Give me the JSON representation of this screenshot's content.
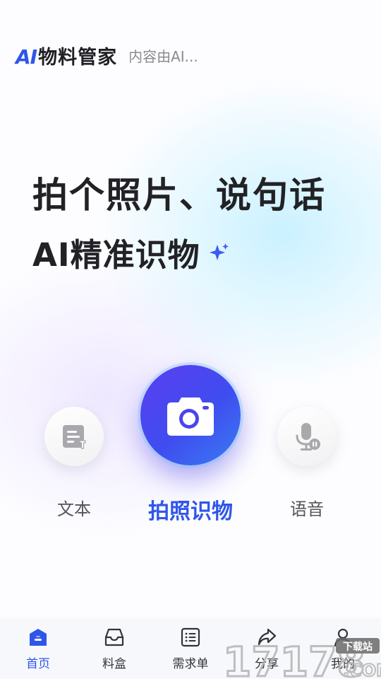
{
  "header": {
    "logo_ai": "AI",
    "logo_cn": "物料管家",
    "tagline": "内容由AI..."
  },
  "hero": {
    "line1": "拍个照片、说句话",
    "line2": "AI精准识物"
  },
  "actions": {
    "text_label": "文本",
    "camera_label": "拍照识物",
    "voice_label": "语音"
  },
  "tabs": [
    {
      "label": "首页",
      "icon": "home-icon",
      "active": true
    },
    {
      "label": "料盒",
      "icon": "inbox-icon",
      "active": false
    },
    {
      "label": "需求单",
      "icon": "list-icon",
      "active": false
    },
    {
      "label": "分享",
      "icon": "share-icon",
      "active": false
    },
    {
      "label": "我的",
      "icon": "user-icon",
      "active": false
    }
  ],
  "watermark": {
    "text": "17178",
    "sub": "下载站",
    "domain": ".COM"
  },
  "colors": {
    "accent": "#2f56ea",
    "camera_gradient_start": "#5b3ef0",
    "camera_gradient_end": "#3a7cf2",
    "text_dark": "#222226",
    "text_muted": "#8a8a90"
  }
}
